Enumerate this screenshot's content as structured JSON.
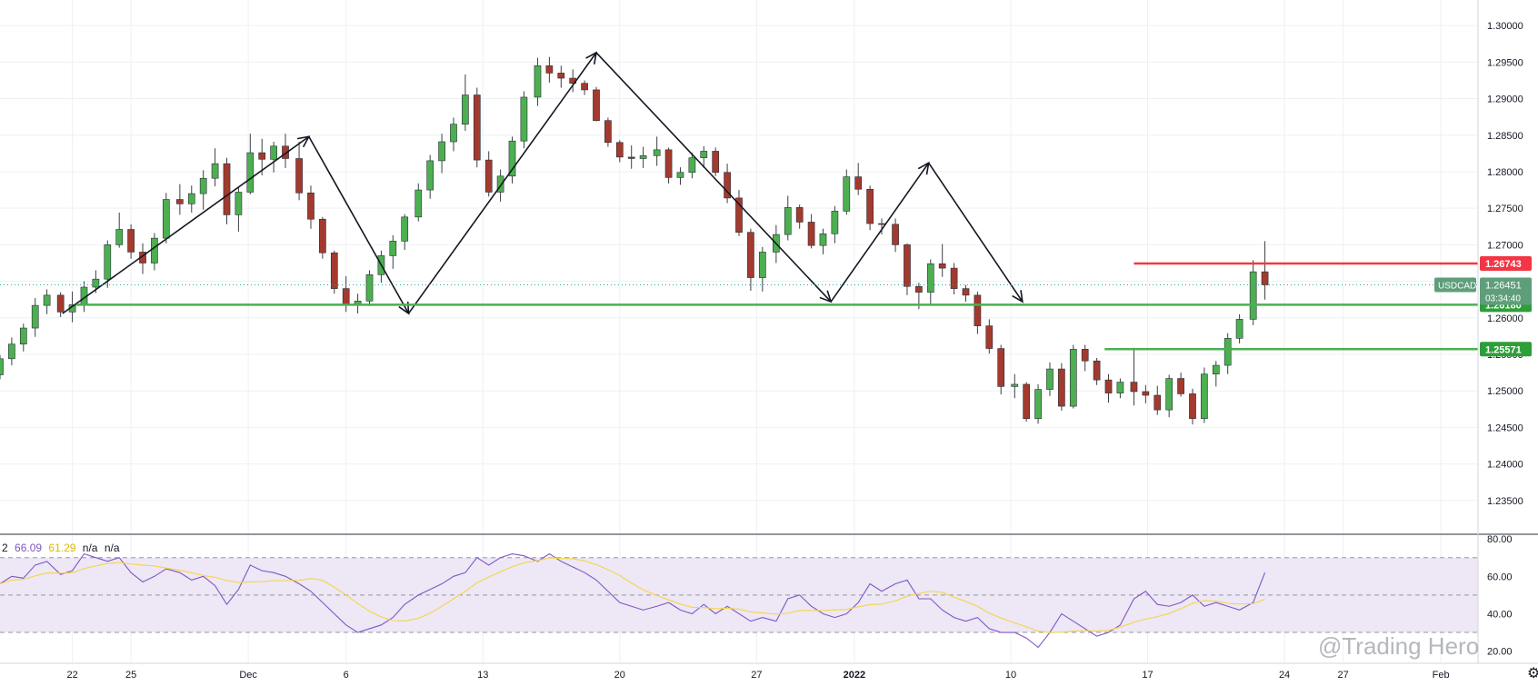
{
  "symbol": "USDCAD",
  "countdown": "03:34:40",
  "watermark": "@Trading Hero",
  "rsi_legend": {
    "period": "2",
    "rsi_value": "66.09",
    "ma_value": "61.29",
    "na1": "n/a",
    "na2": "n/a"
  },
  "colors": {
    "bull": "#26a69a",
    "bear": "#ef5350",
    "bull_body": "#4caf50",
    "bear_body": "#a33a2e",
    "support": "#4caf50",
    "resistance": "#f23645",
    "rsi_line": "#7e57c2",
    "rsi_ma": "#f5d547",
    "rsi_band": "#ede7f6",
    "grid": "#eef0f3",
    "price_tag": "#5f9e7b"
  },
  "chart_data": {
    "type": "candlestick",
    "title": "",
    "symbol": "USDCAD",
    "y_axis_ticks": [
      "1.30000",
      "1.29500",
      "1.29000",
      "1.28500",
      "1.28000",
      "1.27500",
      "1.27000",
      "1.26500",
      "1.26000",
      "1.25500",
      "1.25000",
      "1.24500",
      "1.24000",
      "1.23500"
    ],
    "ylim": [
      1.2305,
      1.3035
    ],
    "x_axis_ticks": [
      {
        "label": "22",
        "day": 3
      },
      {
        "label": "25",
        "day": 6
      },
      {
        "label": "Dec",
        "day": 12
      },
      {
        "label": "6",
        "day": 17
      },
      {
        "label": "13",
        "day": 24
      },
      {
        "label": "20",
        "day": 31
      },
      {
        "label": "27",
        "day": 38
      },
      {
        "label": "2022",
        "day": 43
      },
      {
        "label": "10",
        "day": 51
      },
      {
        "label": "17",
        "day": 58
      },
      {
        "label": "24",
        "day": 65
      },
      {
        "label": "27",
        "day": 68
      },
      {
        "label": "Feb",
        "day": 73
      }
    ],
    "day_range": [
      -0.7,
      74.9
    ],
    "current_price": {
      "label": "1.26451",
      "value": 1.26451
    },
    "horizontal_levels": [
      {
        "label": "1.26743",
        "value": 1.26743,
        "role": "resistance",
        "start_day": 57.3
      },
      {
        "label": "1.26180",
        "value": 1.2618,
        "role": "support",
        "start_day": 3.2
      },
      {
        "label": "1.25571",
        "value": 1.25571,
        "role": "support",
        "start_day": 55.8
      }
    ],
    "zigzag": [
      {
        "day": 2.5,
        "value": 1.2606
      },
      {
        "day": 15.1,
        "value": 1.2848
      },
      {
        "day": 20.2,
        "value": 1.2606
      },
      {
        "day": 29.8,
        "value": 1.2963
      },
      {
        "day": 41.8,
        "value": 1.2622
      },
      {
        "day": 46.8,
        "value": 1.2812
      },
      {
        "day": 51.6,
        "value": 1.2622
      }
    ],
    "ohlc_days": [
      -0.7,
      -0.1,
      0.5,
      1.1,
      1.7,
      2.4,
      3,
      3.6,
      4.2,
      4.8,
      5.4,
      6,
      6.6,
      7.2,
      7.8,
      8.5,
      9.1,
      9.7,
      10.3,
      10.9,
      11.5,
      12.1,
      12.7,
      13.3,
      13.9,
      14.6,
      15.2,
      15.8,
      16.4,
      17,
      17.6,
      18.2,
      18.8,
      19.4,
      20,
      20.7,
      21.3,
      21.9,
      22.5,
      23.1,
      23.7,
      24.3,
      24.9,
      25.5,
      26.1,
      26.8,
      27.4,
      28,
      28.6,
      29.2,
      29.8,
      30.4,
      31,
      31.6,
      32.2,
      32.9,
      33.5,
      34.1,
      34.7,
      35.3,
      35.9,
      36.5,
      37.1,
      37.7,
      38.3,
      39,
      39.6,
      40.2,
      40.8,
      41.4,
      42,
      42.6,
      43.2,
      43.8,
      44.4,
      45.1,
      45.7,
      46.3,
      46.9,
      47.5,
      48.1,
      48.7,
      49.3,
      49.9,
      50.5,
      51.2,
      51.8,
      52.4,
      53,
      53.6,
      54.2,
      54.8,
      55.4,
      56,
      56.6,
      57.3,
      57.9,
      58.5,
      59.1,
      59.7,
      60.3,
      60.9,
      61.5,
      62.1,
      62.7,
      63.4,
      64
    ],
    "ohlc": [
      [
        1.2522,
        1.2549,
        1.2516,
        1.2544
      ],
      [
        1.2544,
        1.2573,
        1.2535,
        1.2564
      ],
      [
        1.2564,
        1.2592,
        1.2554,
        1.2586
      ],
      [
        1.2586,
        1.2627,
        1.2574,
        1.2617
      ],
      [
        1.2617,
        1.2639,
        1.2605,
        1.2631
      ],
      [
        1.2631,
        1.2635,
        1.2601,
        1.2608
      ],
      [
        1.2608,
        1.2636,
        1.2594,
        1.2618
      ],
      [
        1.2618,
        1.265,
        1.2608,
        1.2642
      ],
      [
        1.2642,
        1.2665,
        1.2634,
        1.2653
      ],
      [
        1.2653,
        1.2706,
        1.2641,
        1.27
      ],
      [
        1.27,
        1.2744,
        1.2696,
        1.2721
      ],
      [
        1.2721,
        1.2728,
        1.2681,
        1.269
      ],
      [
        1.269,
        1.2702,
        1.266,
        1.2675
      ],
      [
        1.2675,
        1.2716,
        1.2665,
        1.2709
      ],
      [
        1.2709,
        1.2771,
        1.2702,
        1.2762
      ],
      [
        1.2762,
        1.2783,
        1.2741,
        1.2756
      ],
      [
        1.2756,
        1.2781,
        1.2744,
        1.277
      ],
      [
        1.277,
        1.2802,
        1.2748,
        1.2791
      ],
      [
        1.2791,
        1.2832,
        1.278,
        1.2811
      ],
      [
        1.2811,
        1.2819,
        1.2728,
        1.2741
      ],
      [
        1.2741,
        1.2778,
        1.2718,
        1.2772
      ],
      [
        1.2772,
        1.2852,
        1.2769,
        1.2826
      ],
      [
        1.2826,
        1.2845,
        1.2795,
        1.2817
      ],
      [
        1.2817,
        1.2841,
        1.2799,
        1.2835
      ],
      [
        1.2835,
        1.2852,
        1.2805,
        1.2818
      ],
      [
        1.2818,
        1.2841,
        1.2761,
        1.2771
      ],
      [
        1.2771,
        1.2781,
        1.2722,
        1.2735
      ],
      [
        1.2735,
        1.2738,
        1.2681,
        1.2689
      ],
      [
        1.2689,
        1.2692,
        1.2633,
        1.264
      ],
      [
        1.264,
        1.2657,
        1.2608,
        1.2619
      ],
      [
        1.2619,
        1.2633,
        1.2606,
        1.2623
      ],
      [
        1.2623,
        1.2665,
        1.2616,
        1.2659
      ],
      [
        1.2659,
        1.2692,
        1.2648,
        1.2685
      ],
      [
        1.2685,
        1.2713,
        1.2667,
        1.2705
      ],
      [
        1.2705,
        1.2742,
        1.2693,
        1.2738
      ],
      [
        1.2738,
        1.2784,
        1.2732,
        1.2775
      ],
      [
        1.2775,
        1.2823,
        1.2763,
        1.2815
      ],
      [
        1.2815,
        1.2852,
        1.2798,
        1.2841
      ],
      [
        1.2841,
        1.2874,
        1.2828,
        1.2865
      ],
      [
        1.2865,
        1.2933,
        1.2856,
        1.2905
      ],
      [
        1.2905,
        1.2915,
        1.2806,
        1.2816
      ],
      [
        1.2816,
        1.2828,
        1.2766,
        1.2772
      ],
      [
        1.2772,
        1.2803,
        1.2759,
        1.2794
      ],
      [
        1.2794,
        1.2848,
        1.2784,
        1.2842
      ],
      [
        1.2842,
        1.291,
        1.2832,
        1.2902
      ],
      [
        1.2902,
        1.2956,
        1.289,
        1.2945
      ],
      [
        1.2945,
        1.2957,
        1.2922,
        1.2935
      ],
      [
        1.2935,
        1.2945,
        1.2915,
        1.2928
      ],
      [
        1.2928,
        1.294,
        1.2909,
        1.2921
      ],
      [
        1.2921,
        1.2925,
        1.2905,
        1.2912
      ],
      [
        1.2912,
        1.2916,
        1.2869,
        1.287
      ],
      [
        1.287,
        1.2874,
        1.2834,
        1.284
      ],
      [
        1.284,
        1.2843,
        1.2813,
        1.282
      ],
      [
        1.282,
        1.2836,
        1.2804,
        1.2818
      ],
      [
        1.2818,
        1.2834,
        1.2805,
        1.2822
      ],
      [
        1.2822,
        1.2848,
        1.2808,
        1.283
      ],
      [
        1.283,
        1.2833,
        1.2784,
        1.2792
      ],
      [
        1.2792,
        1.2806,
        1.2782,
        1.2799
      ],
      [
        1.2799,
        1.2826,
        1.2791,
        1.2819
      ],
      [
        1.2819,
        1.2835,
        1.2805,
        1.2828
      ],
      [
        1.2828,
        1.2833,
        1.2794,
        1.2799
      ],
      [
        1.2799,
        1.2811,
        1.2757,
        1.2764
      ],
      [
        1.2764,
        1.2775,
        1.2712,
        1.2717
      ],
      [
        1.2717,
        1.2722,
        1.2637,
        1.2655
      ],
      [
        1.2655,
        1.2697,
        1.2636,
        1.269
      ],
      [
        1.269,
        1.2727,
        1.2675,
        1.2714
      ],
      [
        1.2714,
        1.2767,
        1.2706,
        1.2751
      ],
      [
        1.2751,
        1.2755,
        1.2722,
        1.2731
      ],
      [
        1.2731,
        1.2742,
        1.2695,
        1.2699
      ],
      [
        1.2699,
        1.2722,
        1.2687,
        1.2715
      ],
      [
        1.2715,
        1.2753,
        1.2702,
        1.2746
      ],
      [
        1.2746,
        1.2803,
        1.2741,
        1.2793
      ],
      [
        1.2793,
        1.2812,
        1.2768,
        1.2776
      ],
      [
        1.2776,
        1.2781,
        1.272,
        1.2729
      ],
      [
        1.2729,
        1.2736,
        1.2714,
        1.2728
      ],
      [
        1.2728,
        1.2736,
        1.269,
        1.27
      ],
      [
        1.27,
        1.2702,
        1.2631,
        1.2643
      ],
      [
        1.2643,
        1.2648,
        1.2612,
        1.2635
      ],
      [
        1.2635,
        1.268,
        1.2619,
        1.2674
      ],
      [
        1.2674,
        1.2701,
        1.2656,
        1.2668
      ],
      [
        1.2668,
        1.2675,
        1.2632,
        1.264
      ],
      [
        1.264,
        1.2645,
        1.2622,
        1.2631
      ],
      [
        1.2631,
        1.2636,
        1.2578,
        1.2589
      ],
      [
        1.2589,
        1.2598,
        1.2551,
        1.2558
      ],
      [
        1.2558,
        1.2563,
        1.2495,
        1.2506
      ],
      [
        1.2506,
        1.2523,
        1.249,
        1.2509
      ],
      [
        1.2509,
        1.2512,
        1.2458,
        1.2462
      ],
      [
        1.2462,
        1.2509,
        1.2455,
        1.2502
      ],
      [
        1.2502,
        1.2539,
        1.2493,
        1.253
      ],
      [
        1.253,
        1.2538,
        1.2473,
        1.2479
      ],
      [
        1.2479,
        1.2563,
        1.2476,
        1.2557
      ],
      [
        1.2557,
        1.2563,
        1.2527,
        1.2541
      ],
      [
        1.2541,
        1.2545,
        1.2508,
        1.2515
      ],
      [
        1.2515,
        1.2523,
        1.2484,
        1.2497
      ],
      [
        1.2497,
        1.2517,
        1.249,
        1.2512
      ],
      [
        1.2512,
        1.2559,
        1.248,
        1.2499
      ],
      [
        1.2499,
        1.2508,
        1.2483,
        1.2494
      ],
      [
        1.2494,
        1.2507,
        1.2467,
        1.2474
      ],
      [
        1.2474,
        1.2522,
        1.2464,
        1.2517
      ],
      [
        1.2517,
        1.2525,
        1.2492,
        1.2496
      ],
      [
        1.2496,
        1.2503,
        1.2454,
        1.2462
      ],
      [
        1.2462,
        1.2532,
        1.2456,
        1.2523
      ],
      [
        1.2523,
        1.2541,
        1.2506,
        1.2535
      ],
      [
        1.2535,
        1.2579,
        1.2523,
        1.2572
      ],
      [
        1.2572,
        1.2605,
        1.2565,
        1.2598
      ],
      [
        1.2598,
        1.2679,
        1.259,
        1.2663
      ],
      [
        1.2663,
        1.2705,
        1.2625,
        1.2645
      ]
    ],
    "rsi": {
      "levels": [
        80,
        60,
        40,
        20
      ],
      "band": [
        30,
        70
      ],
      "ylim": [
        14,
        82
      ],
      "days": [
        -0.7,
        -0.1,
        0.5,
        1.1,
        1.7,
        2.4,
        3,
        3.6,
        4.2,
        4.8,
        5.4,
        6,
        6.6,
        7.2,
        7.8,
        8.5,
        9.1,
        9.7,
        10.3,
        10.9,
        11.5,
        12.1,
        12.7,
        13.3,
        13.9,
        14.6,
        15.2,
        15.8,
        16.4,
        17,
        17.6,
        18.2,
        18.8,
        19.4,
        20,
        20.7,
        21.3,
        21.9,
        22.5,
        23.1,
        23.7,
        24.3,
        24.9,
        25.5,
        26.1,
        26.8,
        27.4,
        28,
        28.6,
        29.2,
        29.8,
        30.4,
        31,
        31.6,
        32.2,
        32.9,
        33.5,
        34.1,
        34.7,
        35.3,
        35.9,
        36.5,
        37.1,
        37.7,
        38.3,
        39,
        39.6,
        40.2,
        40.8,
        41.4,
        42,
        42.6,
        43.2,
        43.8,
        44.4,
        45.1,
        45.7,
        46.3,
        46.9,
        47.5,
        48.1,
        48.7,
        49.3,
        49.9,
        50.5,
        51.2,
        51.8,
        52.4,
        53,
        53.6,
        54.2,
        54.8,
        55.4,
        56,
        56.6,
        57.3,
        57.9,
        58.5,
        59.1,
        59.7,
        60.3,
        60.9,
        61.5,
        62.1,
        62.7,
        63.4,
        64
      ],
      "values": [
        56,
        60,
        59,
        66,
        68,
        61,
        63,
        72,
        70,
        68,
        70,
        62,
        57,
        60,
        64,
        62,
        58,
        60,
        55,
        45,
        53,
        66,
        63,
        62,
        60,
        56,
        52,
        46,
        40,
        34,
        30,
        32,
        34,
        38,
        45,
        50,
        53,
        56,
        60,
        62,
        70,
        66,
        70,
        72,
        71,
        68,
        72,
        68,
        65,
        62,
        58,
        52,
        46,
        44,
        42,
        44,
        46,
        42,
        40,
        45,
        40,
        44,
        40,
        36,
        38,
        36,
        48,
        50,
        44,
        40,
        38,
        40,
        46,
        56,
        52,
        56,
        58,
        48,
        48,
        42,
        38,
        36,
        38,
        32,
        30,
        30,
        27,
        22,
        30,
        40,
        36,
        32,
        28,
        30,
        34,
        48,
        52,
        45,
        44,
        46,
        50,
        44,
        46,
        44,
        42,
        46,
        62,
        67
      ]
    }
  }
}
